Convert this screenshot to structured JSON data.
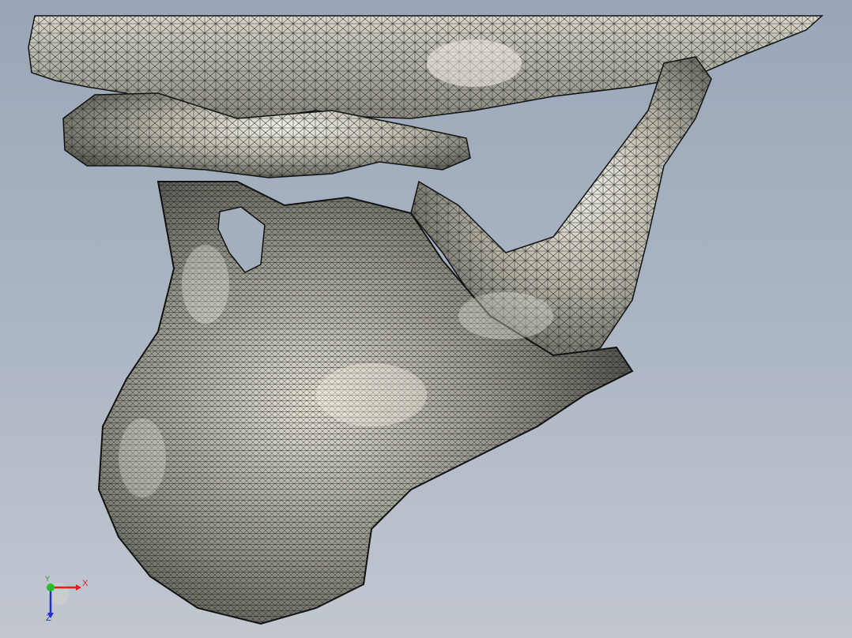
{
  "viewport": {
    "background_top": "#9aa6b8",
    "background_bottom": "#c2c7cf"
  },
  "model": {
    "name": "skull-mandible-mesh",
    "render_style": "shaded-with-edges",
    "surface_color": "#c8c7b8",
    "edge_color": "#1a1a1a"
  },
  "triad": {
    "x_label": "X",
    "y_label": "Y",
    "z_label": "Z",
    "x_color": "#e02020",
    "y_color": "#1a9a1a",
    "z_color": "#2030d0"
  }
}
